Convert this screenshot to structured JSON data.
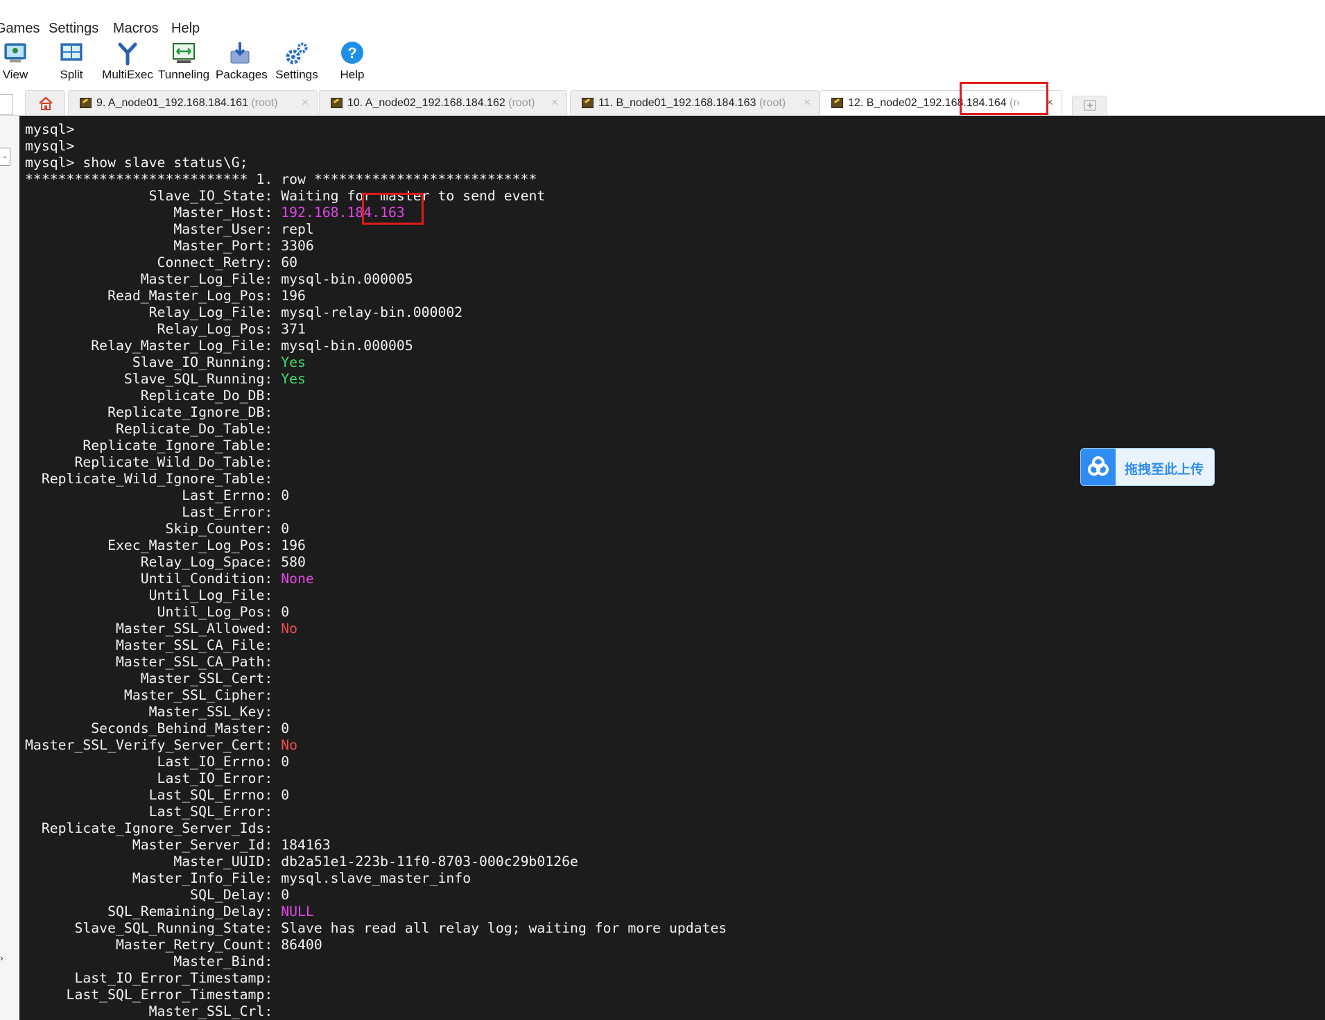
{
  "menu": [
    "Games",
    "Settings",
    "Macros",
    "Help"
  ],
  "toolbar": [
    {
      "label": "View",
      "icon": "view-icon"
    },
    {
      "label": "Split",
      "icon": "split-icon"
    },
    {
      "label": "MultiExec",
      "icon": "multiexec-icon"
    },
    {
      "label": "Tunneling",
      "icon": "tunneling-icon"
    },
    {
      "label": "Packages",
      "icon": "packages-icon"
    },
    {
      "label": "Settings",
      "icon": "settings-icon"
    },
    {
      "label": "Help",
      "icon": "help-icon"
    }
  ],
  "tabs": [
    {
      "label": "9. A_node01_192.168.184.161",
      "user": "(root)",
      "active": false
    },
    {
      "label": "10. A_node02_192.168.184.162",
      "user": "(root)",
      "active": false
    },
    {
      "label": "11. B_node01_192.168.184.163",
      "user": "(root)",
      "active": false
    },
    {
      "label": "12. B_node02_192.168.184.164",
      "user": "(root)",
      "active": true
    }
  ],
  "terminal": {
    "prompts": [
      "mysql>",
      "mysql>",
      "mysql> show slave status\\G;"
    ],
    "row_header": "*************************** 1. row ***************************",
    "fields": [
      {
        "key": "Slave_IO_State",
        "value": "Waiting for master to send event",
        "color": ""
      },
      {
        "key": "Master_Host",
        "value": "192.168.184.163",
        "color": "magenta"
      },
      {
        "key": "Master_User",
        "value": "repl",
        "color": ""
      },
      {
        "key": "Master_Port",
        "value": "3306",
        "color": ""
      },
      {
        "key": "Connect_Retry",
        "value": "60",
        "color": ""
      },
      {
        "key": "Master_Log_File",
        "value": "mysql-bin.000005",
        "color": ""
      },
      {
        "key": "Read_Master_Log_Pos",
        "value": "196",
        "color": ""
      },
      {
        "key": "Relay_Log_File",
        "value": "mysql-relay-bin.000002",
        "color": ""
      },
      {
        "key": "Relay_Log_Pos",
        "value": "371",
        "color": ""
      },
      {
        "key": "Relay_Master_Log_File",
        "value": "mysql-bin.000005",
        "color": ""
      },
      {
        "key": "Slave_IO_Running",
        "value": "Yes",
        "color": "green"
      },
      {
        "key": "Slave_SQL_Running",
        "value": "Yes",
        "color": "green"
      },
      {
        "key": "Replicate_Do_DB",
        "value": "",
        "color": ""
      },
      {
        "key": "Replicate_Ignore_DB",
        "value": "",
        "color": ""
      },
      {
        "key": "Replicate_Do_Table",
        "value": "",
        "color": ""
      },
      {
        "key": "Replicate_Ignore_Table",
        "value": "",
        "color": ""
      },
      {
        "key": "Replicate_Wild_Do_Table",
        "value": "",
        "color": ""
      },
      {
        "key": "Replicate_Wild_Ignore_Table",
        "value": "",
        "color": ""
      },
      {
        "key": "Last_Errno",
        "value": "0",
        "color": ""
      },
      {
        "key": "Last_Error",
        "value": "",
        "color": ""
      },
      {
        "key": "Skip_Counter",
        "value": "0",
        "color": ""
      },
      {
        "key": "Exec_Master_Log_Pos",
        "value": "196",
        "color": ""
      },
      {
        "key": "Relay_Log_Space",
        "value": "580",
        "color": ""
      },
      {
        "key": "Until_Condition",
        "value": "None",
        "color": "magenta"
      },
      {
        "key": "Until_Log_File",
        "value": "",
        "color": ""
      },
      {
        "key": "Until_Log_Pos",
        "value": "0",
        "color": ""
      },
      {
        "key": "Master_SSL_Allowed",
        "value": "No",
        "color": "red"
      },
      {
        "key": "Master_SSL_CA_File",
        "value": "",
        "color": ""
      },
      {
        "key": "Master_SSL_CA_Path",
        "value": "",
        "color": ""
      },
      {
        "key": "Master_SSL_Cert",
        "value": "",
        "color": ""
      },
      {
        "key": "Master_SSL_Cipher",
        "value": "",
        "color": ""
      },
      {
        "key": "Master_SSL_Key",
        "value": "",
        "color": ""
      },
      {
        "key": "Seconds_Behind_Master",
        "value": "0",
        "color": ""
      },
      {
        "key": "Master_SSL_Verify_Server_Cert",
        "value": "No",
        "color": "red"
      },
      {
        "key": "Last_IO_Errno",
        "value": "0",
        "color": ""
      },
      {
        "key": "Last_IO_Error",
        "value": "",
        "color": ""
      },
      {
        "key": "Last_SQL_Errno",
        "value": "0",
        "color": ""
      },
      {
        "key": "Last_SQL_Error",
        "value": "",
        "color": ""
      },
      {
        "key": "Replicate_Ignore_Server_Ids",
        "value": "",
        "color": ""
      },
      {
        "key": "Master_Server_Id",
        "value": "184163",
        "color": ""
      },
      {
        "key": "Master_UUID",
        "value": "db2a51e1-223b-11f0-8703-000c29b0126e",
        "color": ""
      },
      {
        "key": "Master_Info_File",
        "value": "mysql.slave_master_info",
        "color": ""
      },
      {
        "key": "SQL_Delay",
        "value": "0",
        "color": ""
      },
      {
        "key": "SQL_Remaining_Delay",
        "value": "NULL",
        "color": "magenta"
      },
      {
        "key": "Slave_SQL_Running_State",
        "value": "Slave has read all relay log; waiting for more updates",
        "color": ""
      },
      {
        "key": "Master_Retry_Count",
        "value": "86400",
        "color": ""
      },
      {
        "key": "Master_Bind",
        "value": "",
        "color": ""
      },
      {
        "key": "Last_IO_Error_Timestamp",
        "value": "",
        "color": ""
      },
      {
        "key": "Last_SQL_Error_Timestamp",
        "value": "",
        "color": ""
      },
      {
        "key": "Master_SSL_Crl",
        "value": "",
        "color": ""
      }
    ]
  },
  "upload_widget": {
    "label": "拖拽至此上传"
  },
  "colors": {
    "terminal_bg": "#1c1c1c",
    "text": "#f2f2f2",
    "magenta": "#e046e6",
    "green": "#3ddf6d",
    "red": "#f04c4c",
    "highlight": "#e21b1b",
    "accent": "#2f8cf4"
  }
}
